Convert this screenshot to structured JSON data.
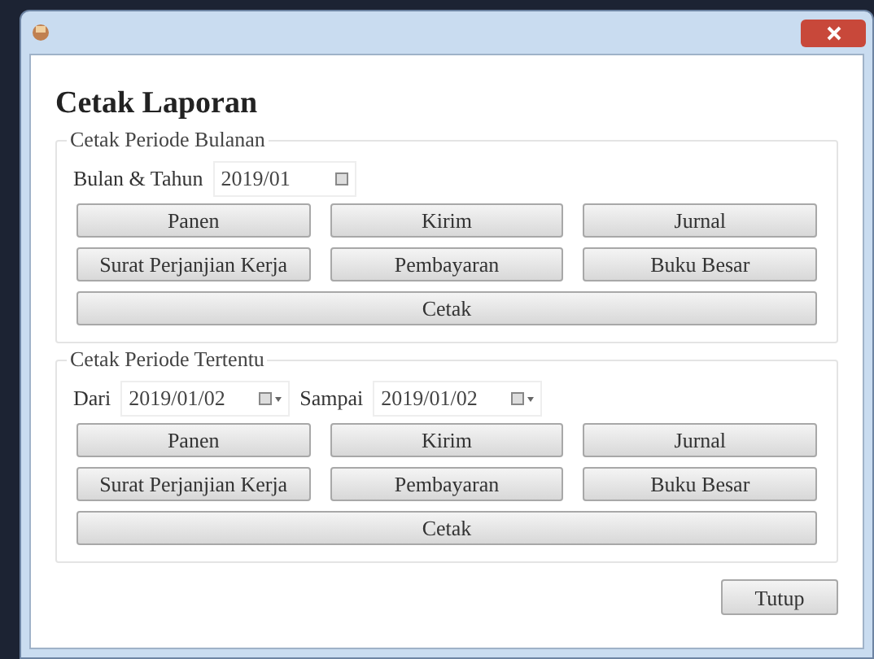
{
  "heading": "Cetak Laporan",
  "groups": [
    {
      "title": "Cetak Periode Bulanan",
      "fields": [
        {
          "label": "Bulan & Tahun",
          "value": "2019/01",
          "dropdown": false
        }
      ],
      "buttons": [
        "Panen",
        "Kirim",
        "Jurnal",
        "Surat Perjanjian Kerja",
        "Pembayaran",
        "Buku Besar"
      ],
      "print_button": "Cetak"
    },
    {
      "title": "Cetak Periode Tertentu",
      "fields": [
        {
          "label": "Dari",
          "value": "2019/01/02",
          "dropdown": true
        },
        {
          "label": "Sampai",
          "value": "2019/01/02",
          "dropdown": true
        }
      ],
      "buttons": [
        "Panen",
        "Kirim",
        "Jurnal",
        "Surat Perjanjian Kerja",
        "Pembayaran",
        "Buku Besar"
      ],
      "print_button": "Cetak"
    }
  ],
  "close_button": "Tutup"
}
